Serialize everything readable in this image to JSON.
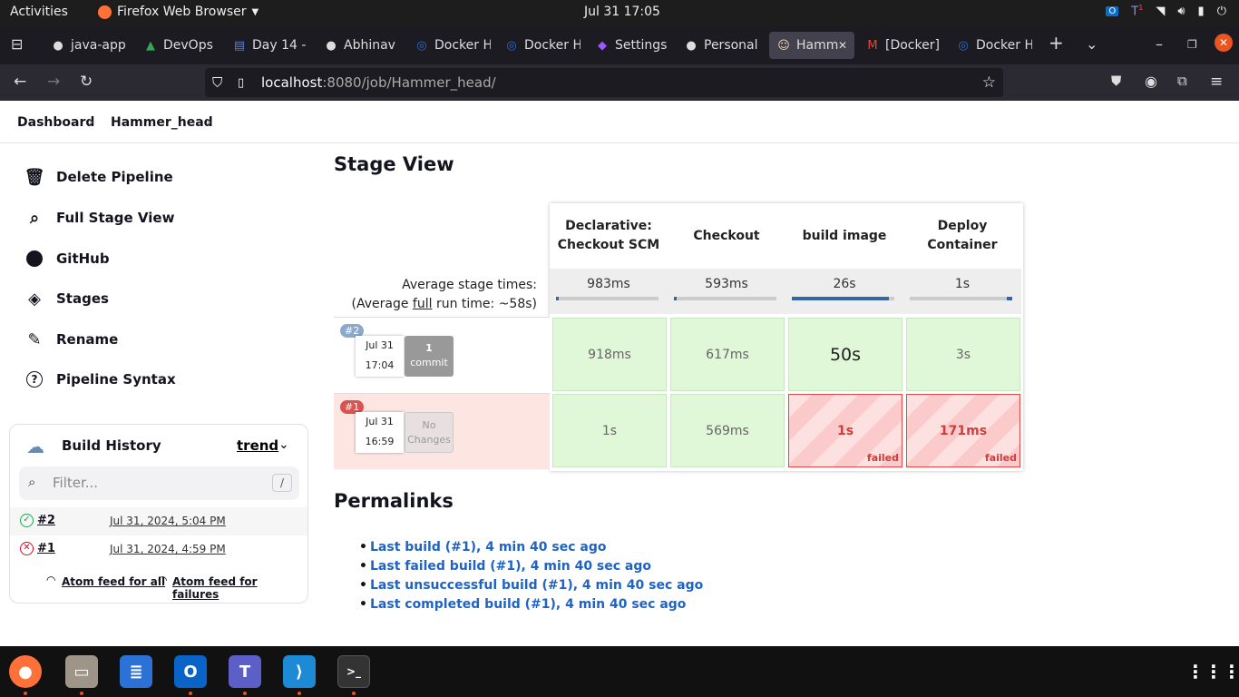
{
  "topbar": {
    "activities": "Activities",
    "app_name": "Firefox Web Browser",
    "clock": "Jul 31  17:05",
    "tray_badge": "1"
  },
  "tabs": [
    {
      "label": "java-app",
      "icon": "github-icon"
    },
    {
      "label": "DevOps",
      "icon": "drive-icon"
    },
    {
      "label": "Day 14 -",
      "icon": "docs-icon"
    },
    {
      "label": "Abhinav",
      "icon": "github-icon"
    },
    {
      "label": "Docker H",
      "icon": "docker-icon"
    },
    {
      "label": "Docker H",
      "icon": "docker-icon"
    },
    {
      "label": "Settings",
      "icon": "settings-icon"
    },
    {
      "label": "Personal",
      "icon": "github-icon"
    },
    {
      "label": "Hamm",
      "icon": "jenkins-icon",
      "active": true
    },
    {
      "label": "[Docker]",
      "icon": "gmail-icon"
    },
    {
      "label": "Docker H",
      "icon": "docker-icon"
    }
  ],
  "url": {
    "host": "localhost",
    "path": ":8080/job/Hammer_head/"
  },
  "breadcrumb": [
    "Dashboard",
    "Hammer_head"
  ],
  "sidebar": {
    "items": [
      {
        "label": "Delete Pipeline",
        "icon": "trash-icon"
      },
      {
        "label": "Full Stage View",
        "icon": "search-icon"
      },
      {
        "label": "GitHub",
        "icon": "github-icon"
      },
      {
        "label": "Stages",
        "icon": "layers-icon"
      },
      {
        "label": "Rename",
        "icon": "pencil-icon"
      },
      {
        "label": "Pipeline Syntax",
        "icon": "help-icon"
      }
    ]
  },
  "build_history": {
    "title": "Build History",
    "trend": "trend",
    "filter_placeholder": "Filter...",
    "filter_shortcut": "/",
    "builds": [
      {
        "id": "#2",
        "date": "Jul 31, 2024, 5:04 PM",
        "status": "success"
      },
      {
        "id": "#1",
        "date": "Jul 31, 2024, 4:59 PM",
        "status": "failed"
      }
    ],
    "feed_all": "Atom feed for all",
    "feed_failures": "Atom feed for failures"
  },
  "stage_view": {
    "title": "Stage View",
    "avg_label": "Average stage times:",
    "avg_full_prefix": "(Average ",
    "avg_full_word": "full",
    "avg_full_suffix": " run time: ~58s)",
    "stages": [
      {
        "name": "Declarative: Checkout SCM",
        "avg": "983ms",
        "avg_fraction": 0.02
      },
      {
        "name": "Checkout",
        "avg": "593ms",
        "avg_fraction": 0.02
      },
      {
        "name": "build image",
        "avg": "26s",
        "avg_fraction": 0.95
      },
      {
        "name": "Deploy Container",
        "avg": "1s",
        "avg_fraction": 0.05
      }
    ],
    "runs": [
      {
        "badge": "#2",
        "date": "Jul 31",
        "time": "17:04",
        "changes": "1",
        "changes_label": "commit",
        "status": "success",
        "cells": [
          {
            "value": "918ms",
            "failed": false
          },
          {
            "value": "617ms",
            "failed": false
          },
          {
            "value": "50s",
            "failed": false,
            "big": true
          },
          {
            "value": "3s",
            "failed": false
          }
        ]
      },
      {
        "badge": "#1",
        "date": "Jul 31",
        "time": "16:59",
        "changes": "No",
        "changes_label": "Changes",
        "status": "failed",
        "cells": [
          {
            "value": "1s",
            "failed": false
          },
          {
            "value": "569ms",
            "failed": false
          },
          {
            "value": "1s",
            "failed": true
          },
          {
            "value": "171ms",
            "failed": true
          }
        ]
      }
    ],
    "failed_label": "failed"
  },
  "permalinks": {
    "title": "Permalinks",
    "links": [
      "Last build (#1), 4 min 40 sec ago",
      "Last failed build (#1), 4 min 40 sec ago",
      "Last unsuccessful build (#1), 4 min 40 sec ago",
      "Last completed build (#1), 4 min 40 sec ago"
    ]
  },
  "dock": [
    "firefox-icon",
    "files-icon",
    "text-editor-icon",
    "outlook-icon",
    "teams-icon",
    "vscode-icon",
    "terminal-icon"
  ]
}
